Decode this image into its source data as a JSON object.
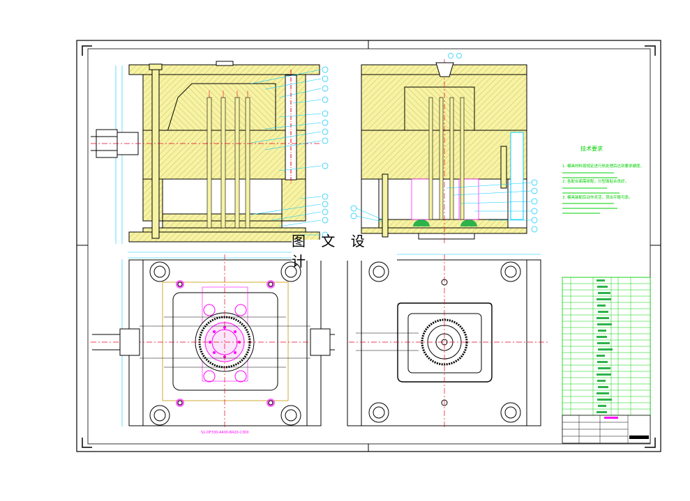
{
  "watermark": "图 文 设 计",
  "tech_requirements": {
    "title": "技术要求",
    "lines": [
      "1. 模具材料按规定进行热处理后达到要求硬度。",
      "2. 各配合面需研配，分型面贴合良好。",
      "3. 模具装配后动作灵活，顶出平稳可靠。"
    ]
  },
  "plan_note": "S1-DF330-A400-B420-C300",
  "colors": {
    "plate_fill": "#f6f3a4",
    "hatch": "#d8c36a",
    "outline": "#000000",
    "centerline": "#e8001c",
    "magenta": "#ff00ff",
    "cyan": "#00c8ff",
    "green": "#00d000",
    "gray_plate": "#ebebeb"
  },
  "icons": [
    "bolt-icon",
    "screw-icon",
    "guide-pillar-icon",
    "water-fitting-icon"
  ]
}
